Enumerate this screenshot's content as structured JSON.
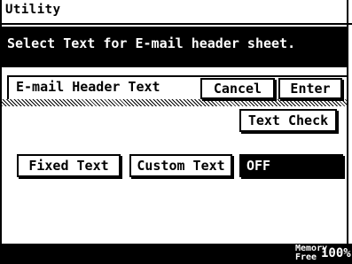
{
  "header": {
    "title": "Utility"
  },
  "message": {
    "text": "Select Text for E-mail header sheet."
  },
  "panel": {
    "label": "E-mail Header Text"
  },
  "buttons": {
    "cancel": "Cancel",
    "enter": "Enter",
    "text_check": "Text Check",
    "fixed_text": "Fixed Text",
    "custom_text": "Custom Text",
    "off": "OFF"
  },
  "status": {
    "memory_label_line1": "Memory",
    "memory_label_line2": "Free",
    "memory_value": "100%"
  },
  "selected_option": "OFF"
}
